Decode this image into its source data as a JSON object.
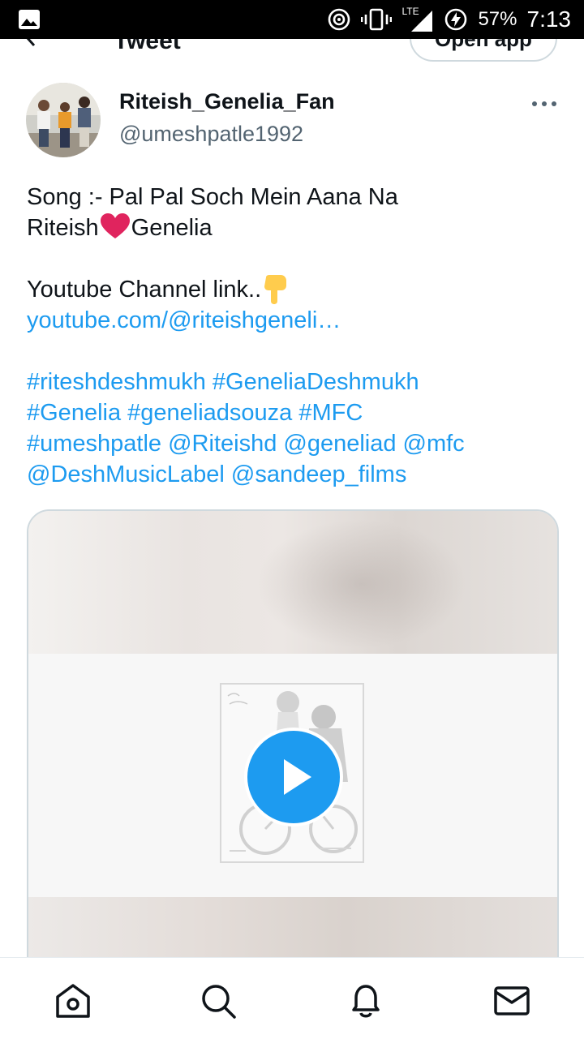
{
  "status_bar": {
    "network": "LTE",
    "battery": "57%",
    "time": "7:13"
  },
  "header": {
    "title": "Tweet",
    "open_app_label": "Open app"
  },
  "author": {
    "name": "Riteish_Genelia_Fan",
    "handle": "@umeshpatle1992"
  },
  "tweet": {
    "line1": "Song :- Pal Pal Soch Mein Aana Na",
    "line2_a": "Riteish",
    "line2_b": "Genelia",
    "line3": "Youtube Channel link..",
    "link": "youtube.com/@riteishgeneli…",
    "hashtags_line1": "#riteshdeshmukh #GeneliaDeshmukh",
    "hashtags_line2": "#Genelia #geneliadsouza #MFC",
    "hashtags_line3": "#umeshpatle @Riteishd @geneliad @mfc",
    "hashtags_line4": "@DeshMusicLabel @sandeep_films"
  },
  "media": {
    "kind": "video",
    "play_icon": "play-icon"
  },
  "bottom_nav": {
    "items": [
      "home-icon",
      "search-icon",
      "notifications-icon",
      "messages-icon"
    ]
  },
  "colors": {
    "link": "#1d9bf0",
    "text": "#0f1419",
    "secondary": "#536471",
    "play": "#1d9bf0"
  }
}
